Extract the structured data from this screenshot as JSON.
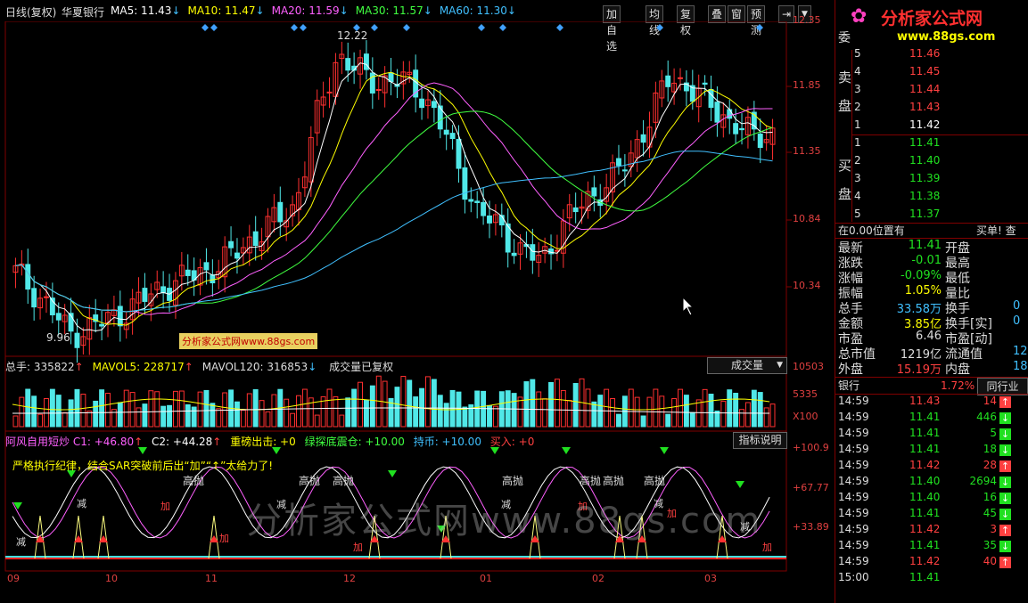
{
  "header": {
    "period": "日线(复权)",
    "stock": "华夏银行",
    "ma": [
      {
        "label": "MA5: 11.43",
        "arrow": "↓",
        "color": "#ffffff"
      },
      {
        "label": "MA10: 11.47",
        "arrow": "↓",
        "color": "#ffff00"
      },
      {
        "label": "MA20: 11.59",
        "arrow": "↓",
        "color": "#ff60ff"
      },
      {
        "label": "MA30: 11.57",
        "arrow": "↓",
        "color": "#40ff40"
      },
      {
        "label": "MA60: 11.30",
        "arrow": "↓",
        "color": "#40c0ff"
      }
    ],
    "buttons": [
      "加自选",
      "均线",
      "复权",
      "叠",
      "窗",
      "预测"
    ]
  },
  "price_axis": [
    "12.35",
    "11.85",
    "11.35",
    "10.84",
    "10.34"
  ],
  "price_annotations": {
    "high": "12.22",
    "low": "9.96"
  },
  "volume": {
    "zongshou_label": "总手: 335822",
    "mavol5": "MAVOL5: 228717",
    "mavol120": "MAVOL120: 316853",
    "note": "成交量已复权",
    "title": "成交量",
    "axis": [
      "10503",
      "5335",
      "X100"
    ]
  },
  "indicator": {
    "name": "阿风自用短炒",
    "c1": "C1: +46.80",
    "c2": "C2: +44.28",
    "zhongqi": "重磅出击: +0",
    "lvtan": "绿探底震仓: +10.00",
    "chibi": "持币: +10.00",
    "mairu": "买入: +0",
    "button": "指标说明",
    "notice": "严格执行纪律，结合SAR突破前后出“加”“↑”太给力了!",
    "axis": [
      "+100.9",
      "+67.77",
      "+33.89"
    ]
  },
  "chart_labels": {
    "sell_signal": "高抛",
    "add_signal": "加",
    "reduce_signal": "减"
  },
  "time_axis": [
    "09",
    "10",
    "11",
    "12",
    "01",
    "02",
    "03"
  ],
  "watermark_site": "分析家公式网www.88gs.com",
  "watermark_big": "分析家公式网www.88gs.com",
  "brand": {
    "name": "分析家公式网",
    "url": "www.88gs.com"
  },
  "order_book": {
    "sell_label": "委",
    "sell_sides": [
      "卖",
      "盘"
    ],
    "buy_sides": [
      "买",
      "盘"
    ],
    "sells": [
      {
        "level": "5",
        "price": "11.46"
      },
      {
        "level": "4",
        "price": "11.45"
      },
      {
        "level": "3",
        "price": "11.44"
      },
      {
        "level": "2",
        "price": "11.43"
      },
      {
        "level": "1",
        "price": "11.42"
      }
    ],
    "buys": [
      {
        "level": "1",
        "price": "11.41"
      },
      {
        "level": "2",
        "price": "11.40"
      },
      {
        "level": "3",
        "price": "11.39"
      },
      {
        "level": "4",
        "price": "11.38"
      },
      {
        "level": "5",
        "price": "11.37"
      }
    ],
    "position": "在0.00位置有",
    "position_right": "买单! 查"
  },
  "quote": [
    {
      "k": "最新",
      "v": "11.41",
      "k2": "开盘",
      "v2": ""
    },
    {
      "k": "涨跌",
      "v": "-0.01",
      "k2": "最高",
      "v2": ""
    },
    {
      "k": "涨幅",
      "v": "-0.09%",
      "k2": "最低",
      "v2": ""
    },
    {
      "k": "振幅",
      "v": "1.05%",
      "k2": "量比",
      "v2": ""
    },
    {
      "k": "总手",
      "v": "33.58万",
      "k2": "换手",
      "v2": "0"
    },
    {
      "k": "金额",
      "v": "3.85亿",
      "k2": "换手[实]",
      "v2": "0"
    },
    {
      "k": "市盈",
      "v": "6.46",
      "k2": "市盈[动]",
      "v2": ""
    },
    {
      "k": "总市值",
      "v": "1219亿",
      "k2": "流通值",
      "v2": "12"
    },
    {
      "k": "外盘",
      "v": "15.19万",
      "k2": "内盘",
      "v2": "18"
    }
  ],
  "sector": {
    "name": "银行",
    "pct": "1.72%",
    "tab": "同行业"
  },
  "ticks": [
    {
      "t": "14:59",
      "p": "11.43",
      "v": "14",
      "d": "up"
    },
    {
      "t": "14:59",
      "p": "11.41",
      "v": "446",
      "d": "down"
    },
    {
      "t": "14:59",
      "p": "11.41",
      "v": "5",
      "d": "down"
    },
    {
      "t": "14:59",
      "p": "11.41",
      "v": "18",
      "d": "down"
    },
    {
      "t": "14:59",
      "p": "11.42",
      "v": "28",
      "d": "up"
    },
    {
      "t": "14:59",
      "p": "11.40",
      "v": "2694",
      "d": "down"
    },
    {
      "t": "14:59",
      "p": "11.40",
      "v": "16",
      "d": "down"
    },
    {
      "t": "14:59",
      "p": "11.41",
      "v": "45",
      "d": "down"
    },
    {
      "t": "14:59",
      "p": "11.42",
      "v": "3",
      "d": "up"
    },
    {
      "t": "14:59",
      "p": "11.41",
      "v": "35",
      "d": "down"
    },
    {
      "t": "14:59",
      "p": "11.42",
      "v": "40",
      "d": "up"
    },
    {
      "t": "15:00",
      "p": "11.41",
      "v": "",
      "d": ""
    }
  ]
}
